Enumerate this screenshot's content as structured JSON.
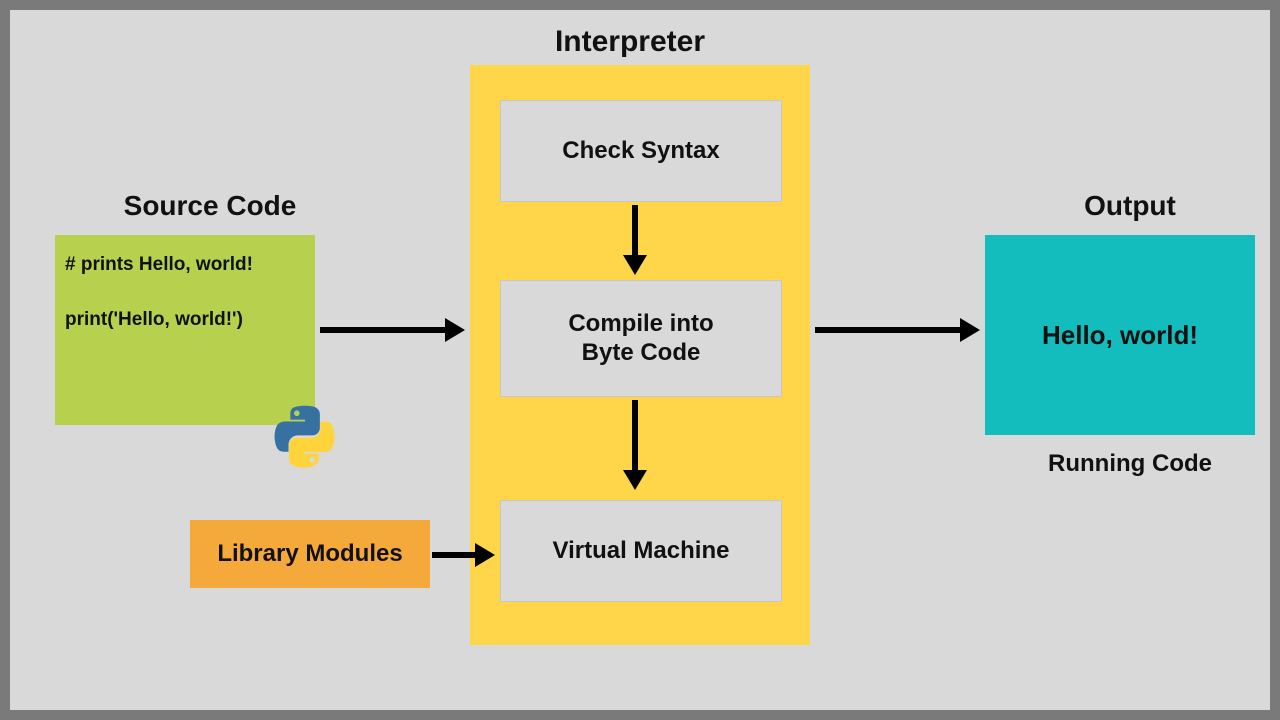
{
  "source": {
    "title": "Source Code",
    "code_line1": "# prints Hello, world!",
    "code_line2": "print('Hello, world!')"
  },
  "library": {
    "label": "Library Modules"
  },
  "interpreter": {
    "title": "Interpreter",
    "stage1": "Check Syntax",
    "stage2_line1": "Compile into",
    "stage2_line2": "Byte Code",
    "stage3": "Virtual Machine"
  },
  "output": {
    "title": "Output",
    "text": "Hello, world!",
    "caption": "Running Code"
  },
  "icons": {
    "python": "python-logo"
  },
  "colors": {
    "source_bg": "#b7d14e",
    "library_bg": "#f5a93b",
    "interpreter_bg": "#ffd54a",
    "stage_bg": "#d9d9d9",
    "output_bg": "#13bdbd",
    "frame_border": "#7a7a7a"
  }
}
